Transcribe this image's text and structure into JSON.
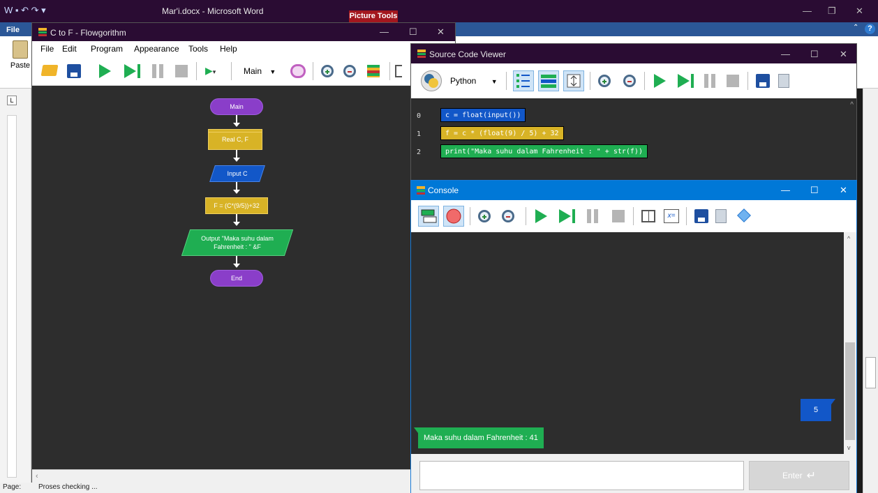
{
  "word": {
    "title": "Mar'i.docx - Microsoft Word",
    "context_tab": "Picture Tools",
    "file_tab": "File",
    "paste_label": "Paste",
    "help_label": "?",
    "status_page": "Page:",
    "status_text": "Proses checking ..."
  },
  "flowgorithm": {
    "title": "C to F - Flowgorithm",
    "menu": [
      "File",
      "Edit",
      "Program",
      "Appearance",
      "Tools",
      "Help"
    ],
    "function_select": "Main",
    "chart": {
      "start": "Main",
      "declare": "Real C, F",
      "input": "Input C",
      "assign": "F = (C*(9/5))+32",
      "output": "Output \"Maka suhu dalam Fahrenheit : \" &F",
      "end": "End"
    }
  },
  "source_viewer": {
    "title": "Source Code Viewer",
    "language": "Python",
    "lines": [
      {
        "num": "0",
        "code": "c = float(input())",
        "color": "#1257c8"
      },
      {
        "num": "1",
        "code": "f = c * (float(9) / 5) + 32",
        "color": "#d8b326"
      },
      {
        "num": "2",
        "code": "print(\"Maka suhu dalam Fahrenheit : \" + str(f))",
        "color": "#1fae52"
      }
    ]
  },
  "console": {
    "title": "Console",
    "input_bubble": "5",
    "output_bubble": "Maka suhu dalam Fahrenheit : 41",
    "input_value": "",
    "enter_label": "Enter"
  },
  "colors": {
    "titlebar": "#2a0c33",
    "console_titlebar": "#0078d7",
    "terminal": "#8a3ec9",
    "declare": "#d8b326",
    "input": "#1257c8",
    "output": "#1fae52"
  }
}
